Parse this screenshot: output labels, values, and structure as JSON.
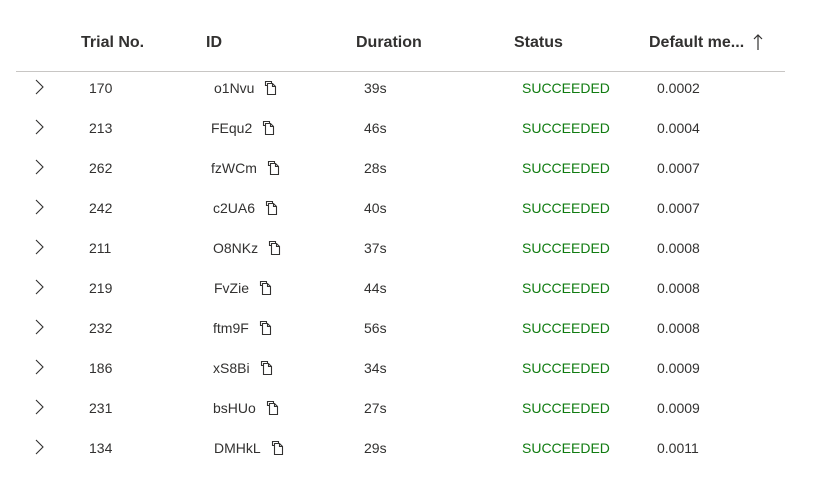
{
  "headers": {
    "trial": "Trial No.",
    "id": "ID",
    "duration": "Duration",
    "status": "Status",
    "metric": "Default me...",
    "sort_icon": "arrow-up-icon"
  },
  "rows": [
    {
      "trial": "170",
      "id": "o1Nvu",
      "duration": "39s",
      "status": "SUCCEEDED",
      "metric": "0.0002"
    },
    {
      "trial": "213",
      "id": "FEqu2",
      "duration": "46s",
      "status": "SUCCEEDED",
      "metric": "0.0004"
    },
    {
      "trial": "262",
      "id": "fzWCm",
      "duration": "28s",
      "status": "SUCCEEDED",
      "metric": "0.0007"
    },
    {
      "trial": "242",
      "id": "c2UA6",
      "duration": "40s",
      "status": "SUCCEEDED",
      "metric": "0.0007"
    },
    {
      "trial": "211",
      "id": "O8NKz",
      "duration": "37s",
      "status": "SUCCEEDED",
      "metric": "0.0008"
    },
    {
      "trial": "219",
      "id": "FvZie",
      "duration": "44s",
      "status": "SUCCEEDED",
      "metric": "0.0008"
    },
    {
      "trial": "232",
      "id": "ftm9F",
      "duration": "56s",
      "status": "SUCCEEDED",
      "metric": "0.0008"
    },
    {
      "trial": "186",
      "id": "xS8Bi",
      "duration": "34s",
      "status": "SUCCEEDED",
      "metric": "0.0009"
    },
    {
      "trial": "231",
      "id": "bsHUo",
      "duration": "27s",
      "status": "SUCCEEDED",
      "metric": "0.0009"
    },
    {
      "trial": "134",
      "id": "DMHkL",
      "duration": "29s",
      "status": "SUCCEEDED",
      "metric": "0.0011"
    }
  ],
  "colors": {
    "status_success": "#107c10",
    "text": "#323130",
    "divider": "#c8c6c4"
  }
}
